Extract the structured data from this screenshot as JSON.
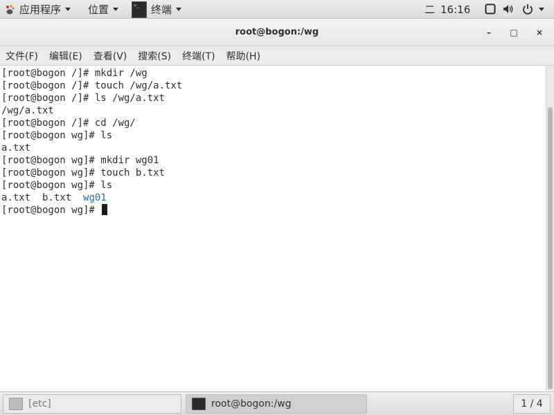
{
  "top_panel": {
    "applications_label": "应用程序",
    "places_label": "位置",
    "terminal_label": "终端",
    "clock_day": "二",
    "clock_time": "16:16",
    "icons": {
      "applications": "gnome-foot-icon",
      "network": "network-icon",
      "volume": "volume-icon",
      "power": "power-icon"
    }
  },
  "window": {
    "title": "root@bogon:/wg",
    "controls": {
      "minimize": "–",
      "maximize": "□",
      "close": "×"
    },
    "menu": [
      "文件(F)",
      "编辑(E)",
      "查看(V)",
      "搜索(S)",
      "终端(T)",
      "帮助(H)"
    ]
  },
  "terminal": {
    "lines": [
      "[root@bogon /]# mkdir /wg",
      "[root@bogon /]# touch /wg/a.txt",
      "[root@bogon /]# ls /wg/a.txt",
      "/wg/a.txt",
      "[root@bogon /]# cd /wg/",
      "[root@bogon wg]# ls",
      "a.txt",
      "[root@bogon wg]# mkdir wg01",
      "[root@bogon wg]# touch b.txt",
      "[root@bogon wg]# ls"
    ],
    "ls_output": {
      "files": "a.txt  b.txt  ",
      "dir": "wg01"
    },
    "prompt": "[root@bogon wg]# ",
    "colors": {
      "directory": "#1f6fbf",
      "text": "#2e2e2e"
    }
  },
  "taskbar": {
    "items": [
      {
        "label": "[etc]"
      },
      {
        "label": "root@bogon:/wg"
      }
    ],
    "workspace": "1 / 4"
  }
}
